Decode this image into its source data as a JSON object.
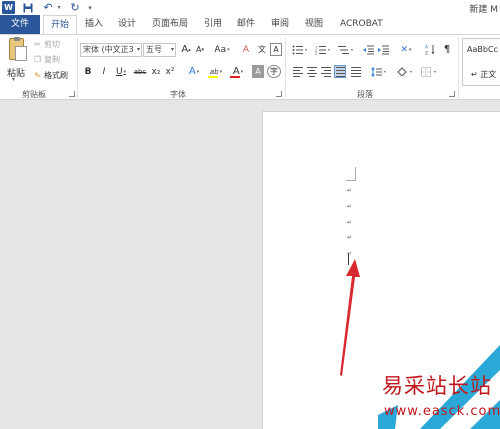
{
  "title_bar": {
    "logo_letter": "W",
    "document_title": "新建 M"
  },
  "tabs": [
    {
      "id": "file",
      "label": "文件"
    },
    {
      "id": "home",
      "label": "开始"
    },
    {
      "id": "insert",
      "label": "插入"
    },
    {
      "id": "design",
      "label": "设计"
    },
    {
      "id": "layout",
      "label": "页面布局"
    },
    {
      "id": "references",
      "label": "引用"
    },
    {
      "id": "mailings",
      "label": "邮件"
    },
    {
      "id": "review",
      "label": "审阅"
    },
    {
      "id": "view",
      "label": "视图"
    },
    {
      "id": "acrobat",
      "label": "ACROBAT"
    }
  ],
  "ribbon": {
    "clipboard": {
      "group_label": "剪贴板",
      "paste_label": "粘贴",
      "cut_label": "剪切",
      "copy_label": "复制",
      "format_painter_label": "格式刷"
    },
    "font": {
      "group_label": "字体",
      "font_name": "宋体 (中文正3",
      "font_size": "五号",
      "grow_font": "A",
      "shrink_font": "A",
      "change_case": "Aa",
      "clear_format": "A",
      "phonetic_guide": "文",
      "char_border": "A",
      "bold": "B",
      "italic": "I",
      "underline": "U",
      "strikethrough": "abc",
      "subscript": "x₂",
      "superscript": "x²",
      "text_effects": "A",
      "highlight": "ab",
      "font_color": "A",
      "char_shading": "A",
      "enclose_char": "字",
      "highlight_color": "#ffff00",
      "font_color_value": "#e02020"
    },
    "paragraph": {
      "group_label": "段落",
      "chinese_layout": "✕"
    },
    "styles": {
      "sample_text": "AaBbCc",
      "style_name": "↵ 正文"
    }
  },
  "document": {
    "paragraph_mark": "↵",
    "empty_paragraph_count": 5
  },
  "watermark": {
    "title": "易采站长站",
    "url": "www.easck.com"
  },
  "colors": {
    "accent": "#2b579a",
    "annotation_arrow": "#d9282f",
    "watermark": "#c0171b"
  }
}
